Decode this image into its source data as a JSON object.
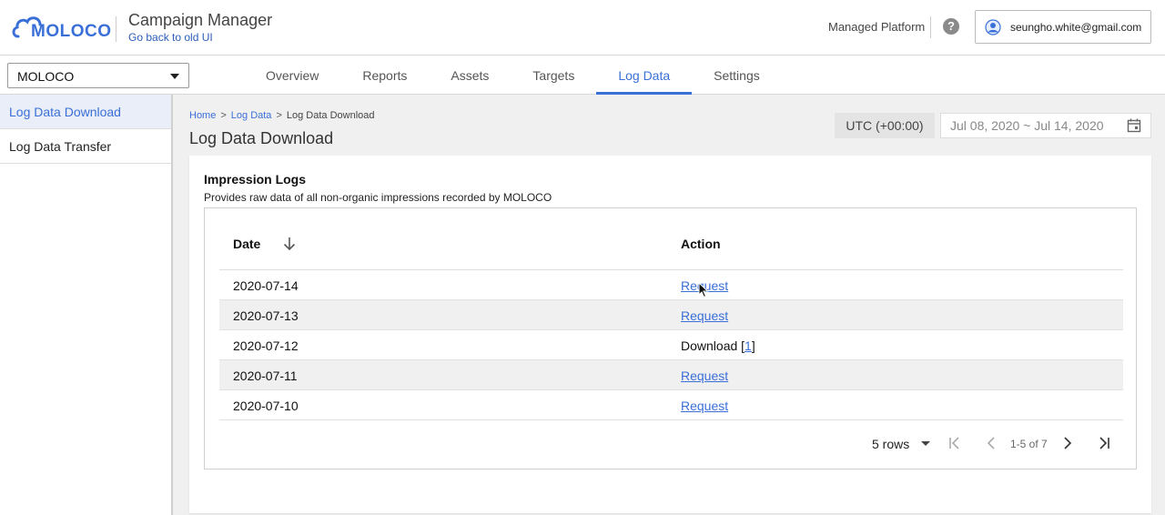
{
  "header": {
    "logo_text": "MOLOCO",
    "app_title": "Campaign Manager",
    "back_link": "Go back to old UI",
    "platform": "Managed Platform",
    "help_glyph": "?",
    "user_email": "seungho.white@gmail.com"
  },
  "account_select": {
    "selected": "MOLOCO"
  },
  "tabs": [
    {
      "label": "Overview"
    },
    {
      "label": "Reports"
    },
    {
      "label": "Assets"
    },
    {
      "label": "Targets"
    },
    {
      "label": "Log Data",
      "active": true
    },
    {
      "label": "Settings"
    }
  ],
  "sidebar": {
    "items": [
      {
        "label": "Log Data Download",
        "active": true
      },
      {
        "label": "Log Data Transfer"
      }
    ]
  },
  "breadcrumb": {
    "home": "Home",
    "section": "Log Data",
    "current": "Log Data Download",
    "separator": ">"
  },
  "page_title": "Log Data Download",
  "timezone": "UTC (+00:00)",
  "date_range": "Jul 08, 2020 ~ Jul 14, 2020",
  "card": {
    "title": "Impression Logs",
    "description": "Provides raw data of all non-organic impressions recorded by MOLOCO"
  },
  "table": {
    "columns": {
      "date": "Date",
      "action": "Action"
    },
    "rows": [
      {
        "date": "2020-07-14",
        "action": "Request"
      },
      {
        "date": "2020-07-13",
        "action": "Request"
      },
      {
        "date": "2020-07-12",
        "action_prefix": "Download [",
        "action_link": "1",
        "action_suffix": "]"
      },
      {
        "date": "2020-07-11",
        "action": "Request"
      },
      {
        "date": "2020-07-10",
        "action": "Request"
      }
    ]
  },
  "pager": {
    "rows_per_page": "5 rows",
    "range": "1-5 of 7"
  },
  "colors": {
    "accent": "#3a6fd8",
    "alt_row": "#f0f0f0"
  }
}
